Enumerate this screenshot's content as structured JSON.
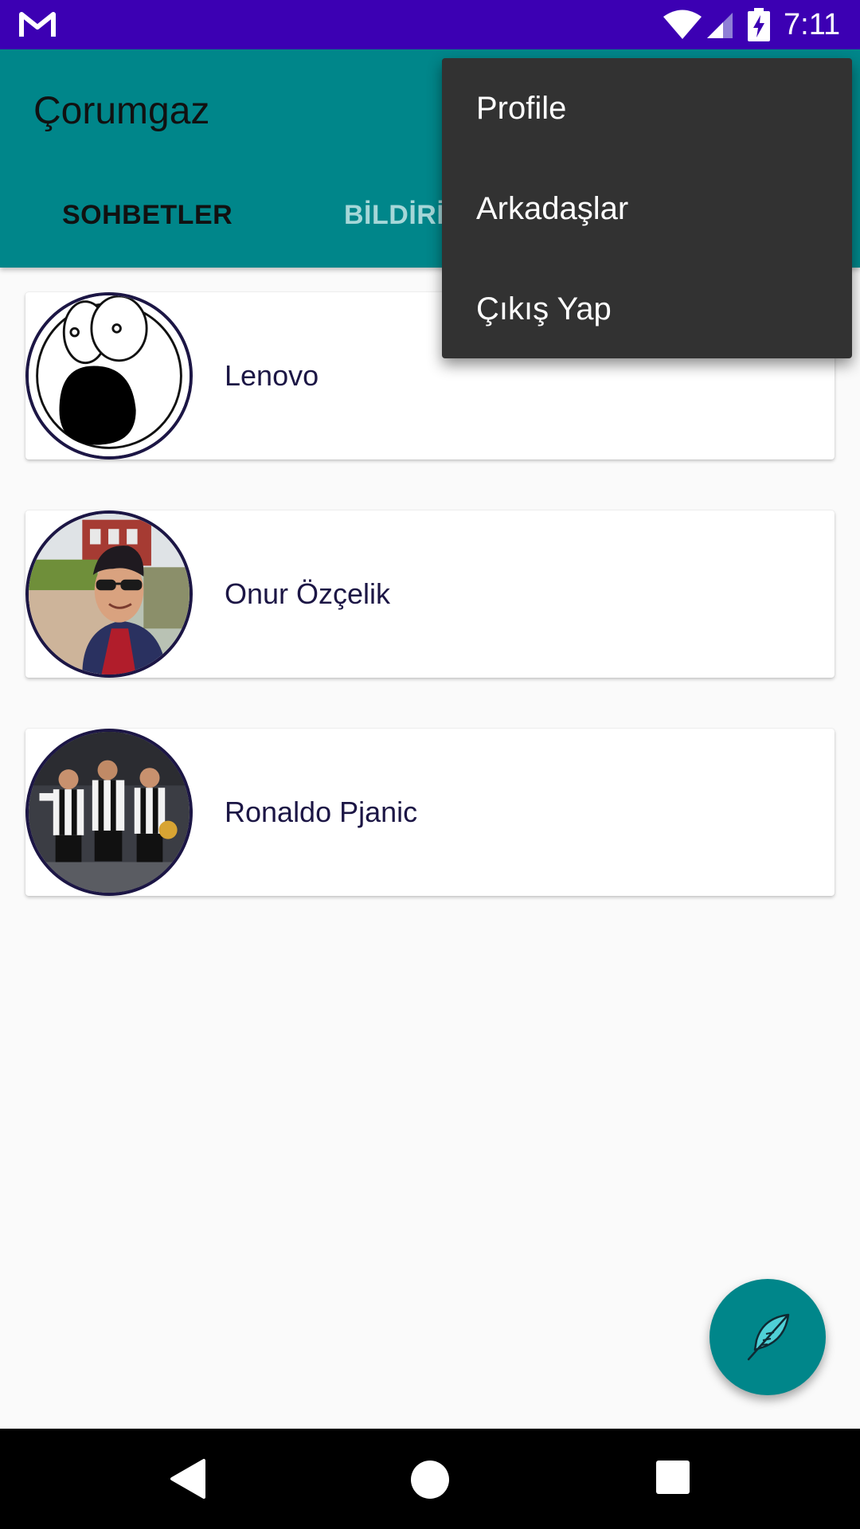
{
  "status_bar": {
    "time": "7:11",
    "icons": [
      "gmail-icon",
      "wifi-icon",
      "signal-icon",
      "battery-charging-icon"
    ]
  },
  "app_bar": {
    "title": "Çorumgaz",
    "tabs": [
      {
        "label": "SOHBETLER",
        "selected": true
      },
      {
        "label": "BİLDİRİ",
        "selected": false
      }
    ]
  },
  "chats": [
    {
      "name": "Lenovo",
      "avatar": "shocked-face-avatar"
    },
    {
      "name": "Onur Özçelik",
      "avatar": "selfie-photo-avatar"
    },
    {
      "name": "Ronaldo Pjanic",
      "avatar": "football-players-photo-avatar"
    }
  ],
  "overflow_menu": {
    "items": [
      "Profile",
      "Arkadaşlar",
      "Çıkış Yap"
    ]
  },
  "fab": {
    "icon": "feather-icon"
  },
  "nav_bar": {
    "icons": [
      "back-icon",
      "home-icon",
      "recents-icon"
    ]
  },
  "colors": {
    "status_bar": "#3c00b3",
    "primary": "#00868a",
    "menu_bg": "#323232",
    "avatar_border": "#1c1645"
  }
}
